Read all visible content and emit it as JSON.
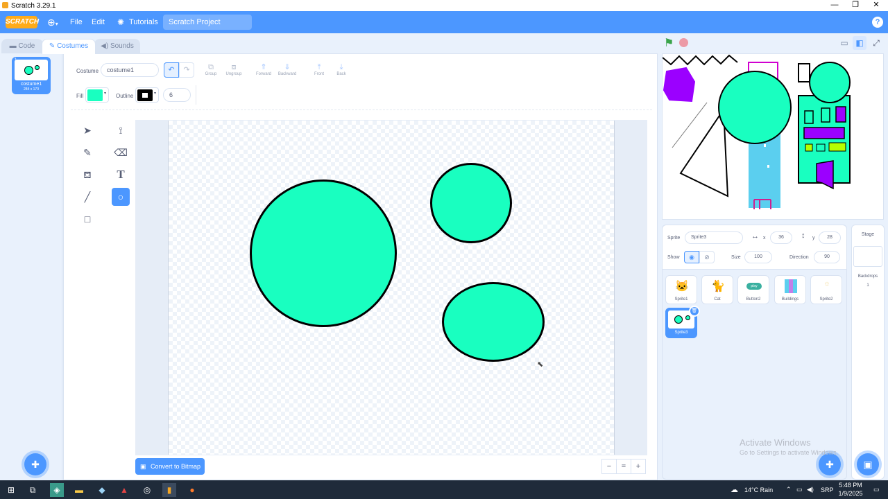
{
  "window": {
    "title": "Scratch 3.29.1",
    "minimize": "—",
    "restore": "❐",
    "close": "✕"
  },
  "menubar": {
    "logo": "SCRATCH",
    "language_icon": "globe-icon",
    "file": "File",
    "edit": "Edit",
    "tutorials": "Tutorials",
    "project_name": "Scratch Project",
    "help": "?"
  },
  "tabs": {
    "code": "Code",
    "costumes": "Costumes",
    "sounds": "Sounds"
  },
  "costume_list": [
    {
      "index": "1",
      "name": "costume1",
      "size": "284 x 170"
    }
  ],
  "paint": {
    "costume_label": "Costume",
    "costume_name": "costume1",
    "group": "Group",
    "ungroup": "Ungroup",
    "forward": "Forward",
    "backward": "Backward",
    "front": "Front",
    "back": "Back",
    "fill_label": "Fill",
    "fill_color": "#19ffc0",
    "outline_label": "Outline",
    "outline_color": "#000000",
    "outline_width": "6",
    "convert": "Convert to Bitmap",
    "zoom_out": "−",
    "zoom_reset": "=",
    "zoom_in": "+",
    "selected_tool": "circle-tool"
  },
  "sprite_info": {
    "sprite_label": "Sprite",
    "sprite_name": "Sprite3",
    "x_label": "x",
    "x": "36",
    "y_label": "y",
    "y": "28",
    "show_label": "Show",
    "size_label": "Size",
    "size": "100",
    "direction_label": "Direction",
    "direction": "90"
  },
  "sprites": [
    {
      "name": "Sprite1"
    },
    {
      "name": "Cat"
    },
    {
      "name": "Button2",
      "badge": "play"
    },
    {
      "name": "Buildings"
    },
    {
      "name": "Sprite2"
    },
    {
      "name": "Sprite3",
      "selected": true
    }
  ],
  "stage_col": {
    "title": "Stage",
    "backdrops_label": "Backdrops",
    "backdrops_count": "1"
  },
  "watermark": {
    "line1": "Activate Windows",
    "line2": "Go to Settings to activate Windows."
  },
  "taskbar": {
    "weather": "14°C  Rain",
    "lang": "SRP",
    "time": "5:48 PM",
    "date": "1/9/2025"
  }
}
